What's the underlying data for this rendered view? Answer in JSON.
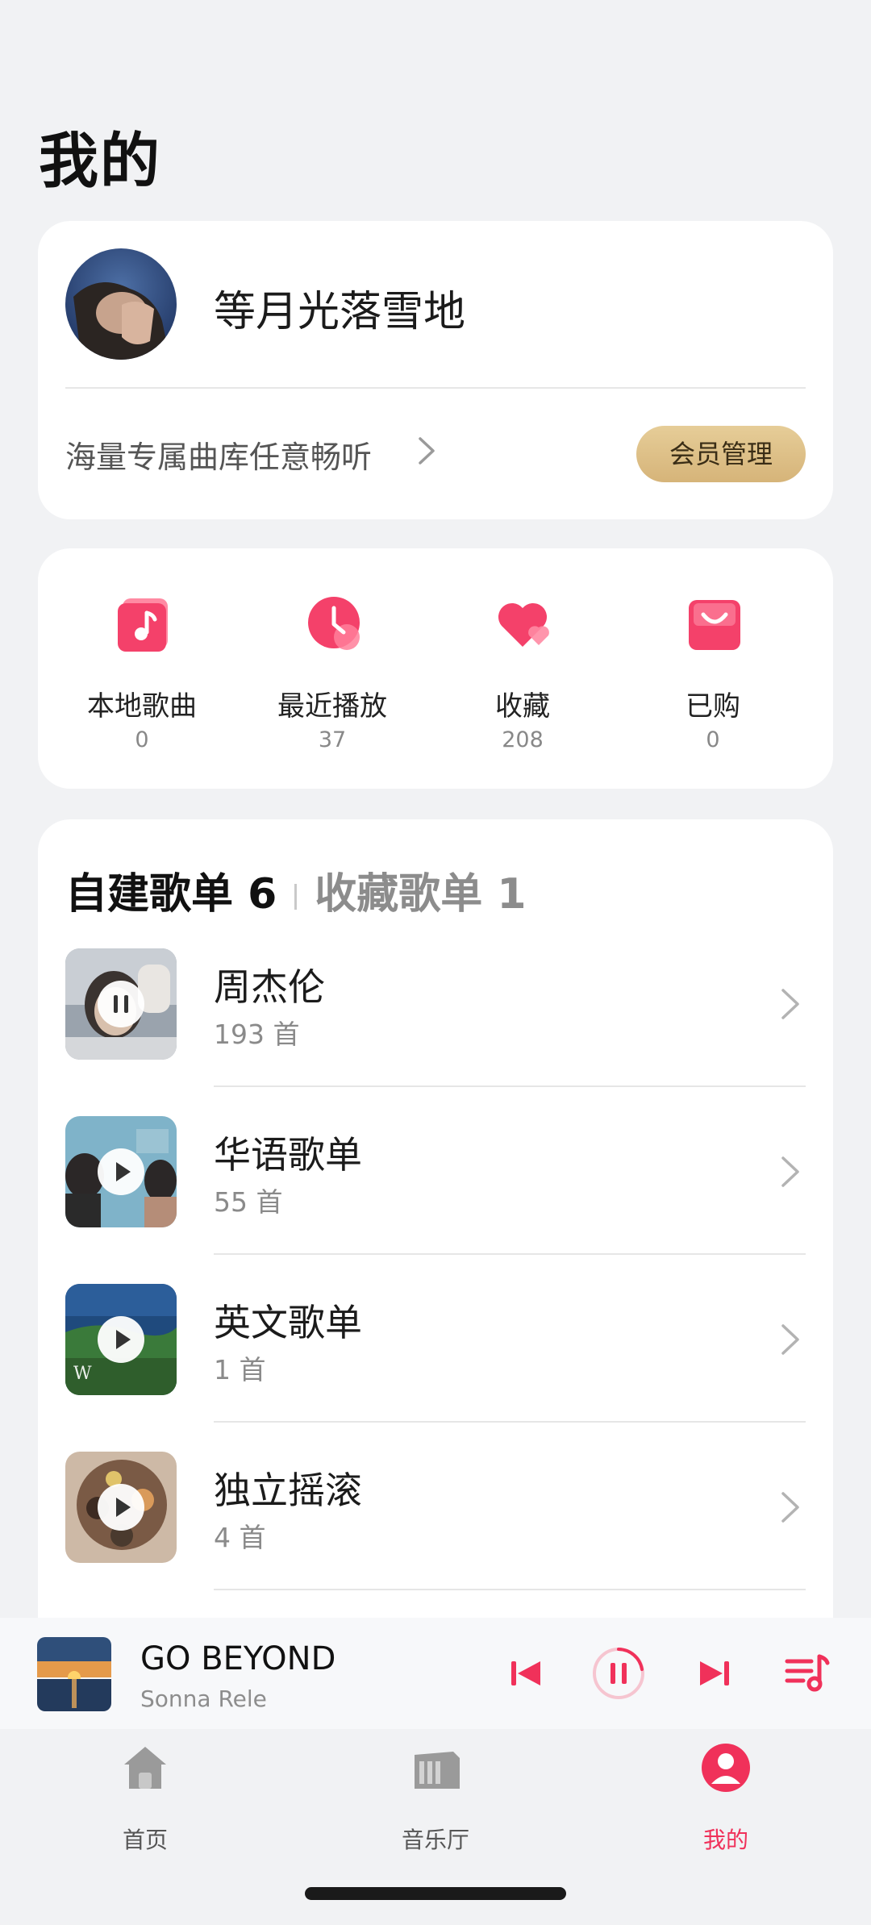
{
  "page": {
    "title": "我的"
  },
  "profile": {
    "username": "等月光落雪地",
    "promo_text": "海量专属曲库任意畅听",
    "vip_button": "会员管理"
  },
  "quick_access": [
    {
      "label": "本地歌曲",
      "count": "0",
      "icon": "music-note-icon"
    },
    {
      "label": "最近播放",
      "count": "37",
      "icon": "clock-icon"
    },
    {
      "label": "收藏",
      "count": "208",
      "icon": "heart-icon"
    },
    {
      "label": "已购",
      "count": "0",
      "icon": "shopping-bag-icon"
    }
  ],
  "playlists": {
    "tab_created": "自建歌单 6",
    "tab_favorited": "收藏歌单 1",
    "items": [
      {
        "title": "周杰伦",
        "count": "193 首",
        "state": "paused"
      },
      {
        "title": "华语歌单",
        "count": "55 首",
        "state": "play"
      },
      {
        "title": "英文歌单",
        "count": "1 首",
        "state": "play"
      },
      {
        "title": "独立摇滚",
        "count": "4 首",
        "state": "play"
      }
    ]
  },
  "now_playing": {
    "title": "GO BEYOND",
    "artist": "Sonna Rele"
  },
  "bottom_nav": [
    {
      "label": "首页",
      "icon": "home-icon",
      "active": false
    },
    {
      "label": "音乐厅",
      "icon": "music-hall-icon",
      "active": false
    },
    {
      "label": "我的",
      "icon": "profile-icon",
      "active": true
    }
  ],
  "colors": {
    "accent": "#f0315a",
    "vip_gold": "#d9b97e",
    "background": "#f1f2f4"
  }
}
